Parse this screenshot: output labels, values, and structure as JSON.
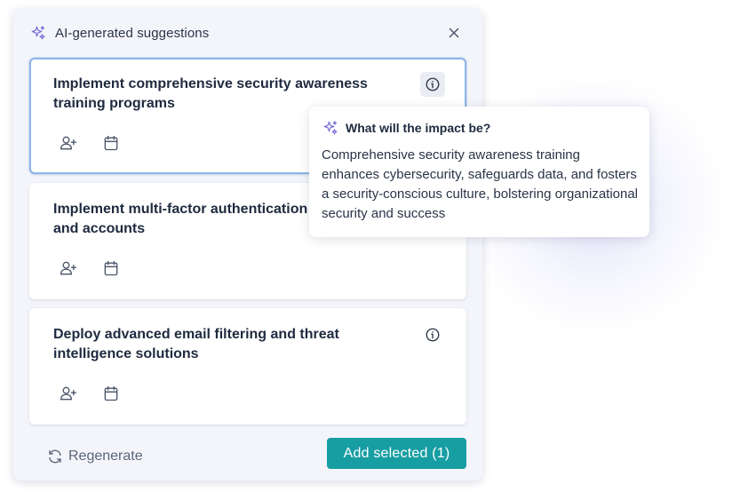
{
  "panel": {
    "title": "AI-generated suggestions",
    "icon": "sparkle-icon",
    "close_icon": "close-icon"
  },
  "suggestions": [
    {
      "title": "Implement comprehensive security awareness training programs",
      "selected": true
    },
    {
      "title": "Implement multi-factor authentication systems and accounts",
      "selected": false
    },
    {
      "title": "Deploy advanced email filtering and threat intelligence solutions",
      "selected": false
    }
  ],
  "footer": {
    "regenerate_label": "Regenerate",
    "add_label": "Add selected (1)"
  },
  "tooltip": {
    "title": "What will the impact be?",
    "body": "Comprehensive security awareness training enhances cybersecurity, safeguards data, and fosters a security-conscious culture, bolstering organizational security and success"
  },
  "colors": {
    "accent": "#179ea3",
    "sparkle": "#7a6fd6",
    "selected_border": "#8fb6e8",
    "panel_bg": "#f4f5fb"
  }
}
